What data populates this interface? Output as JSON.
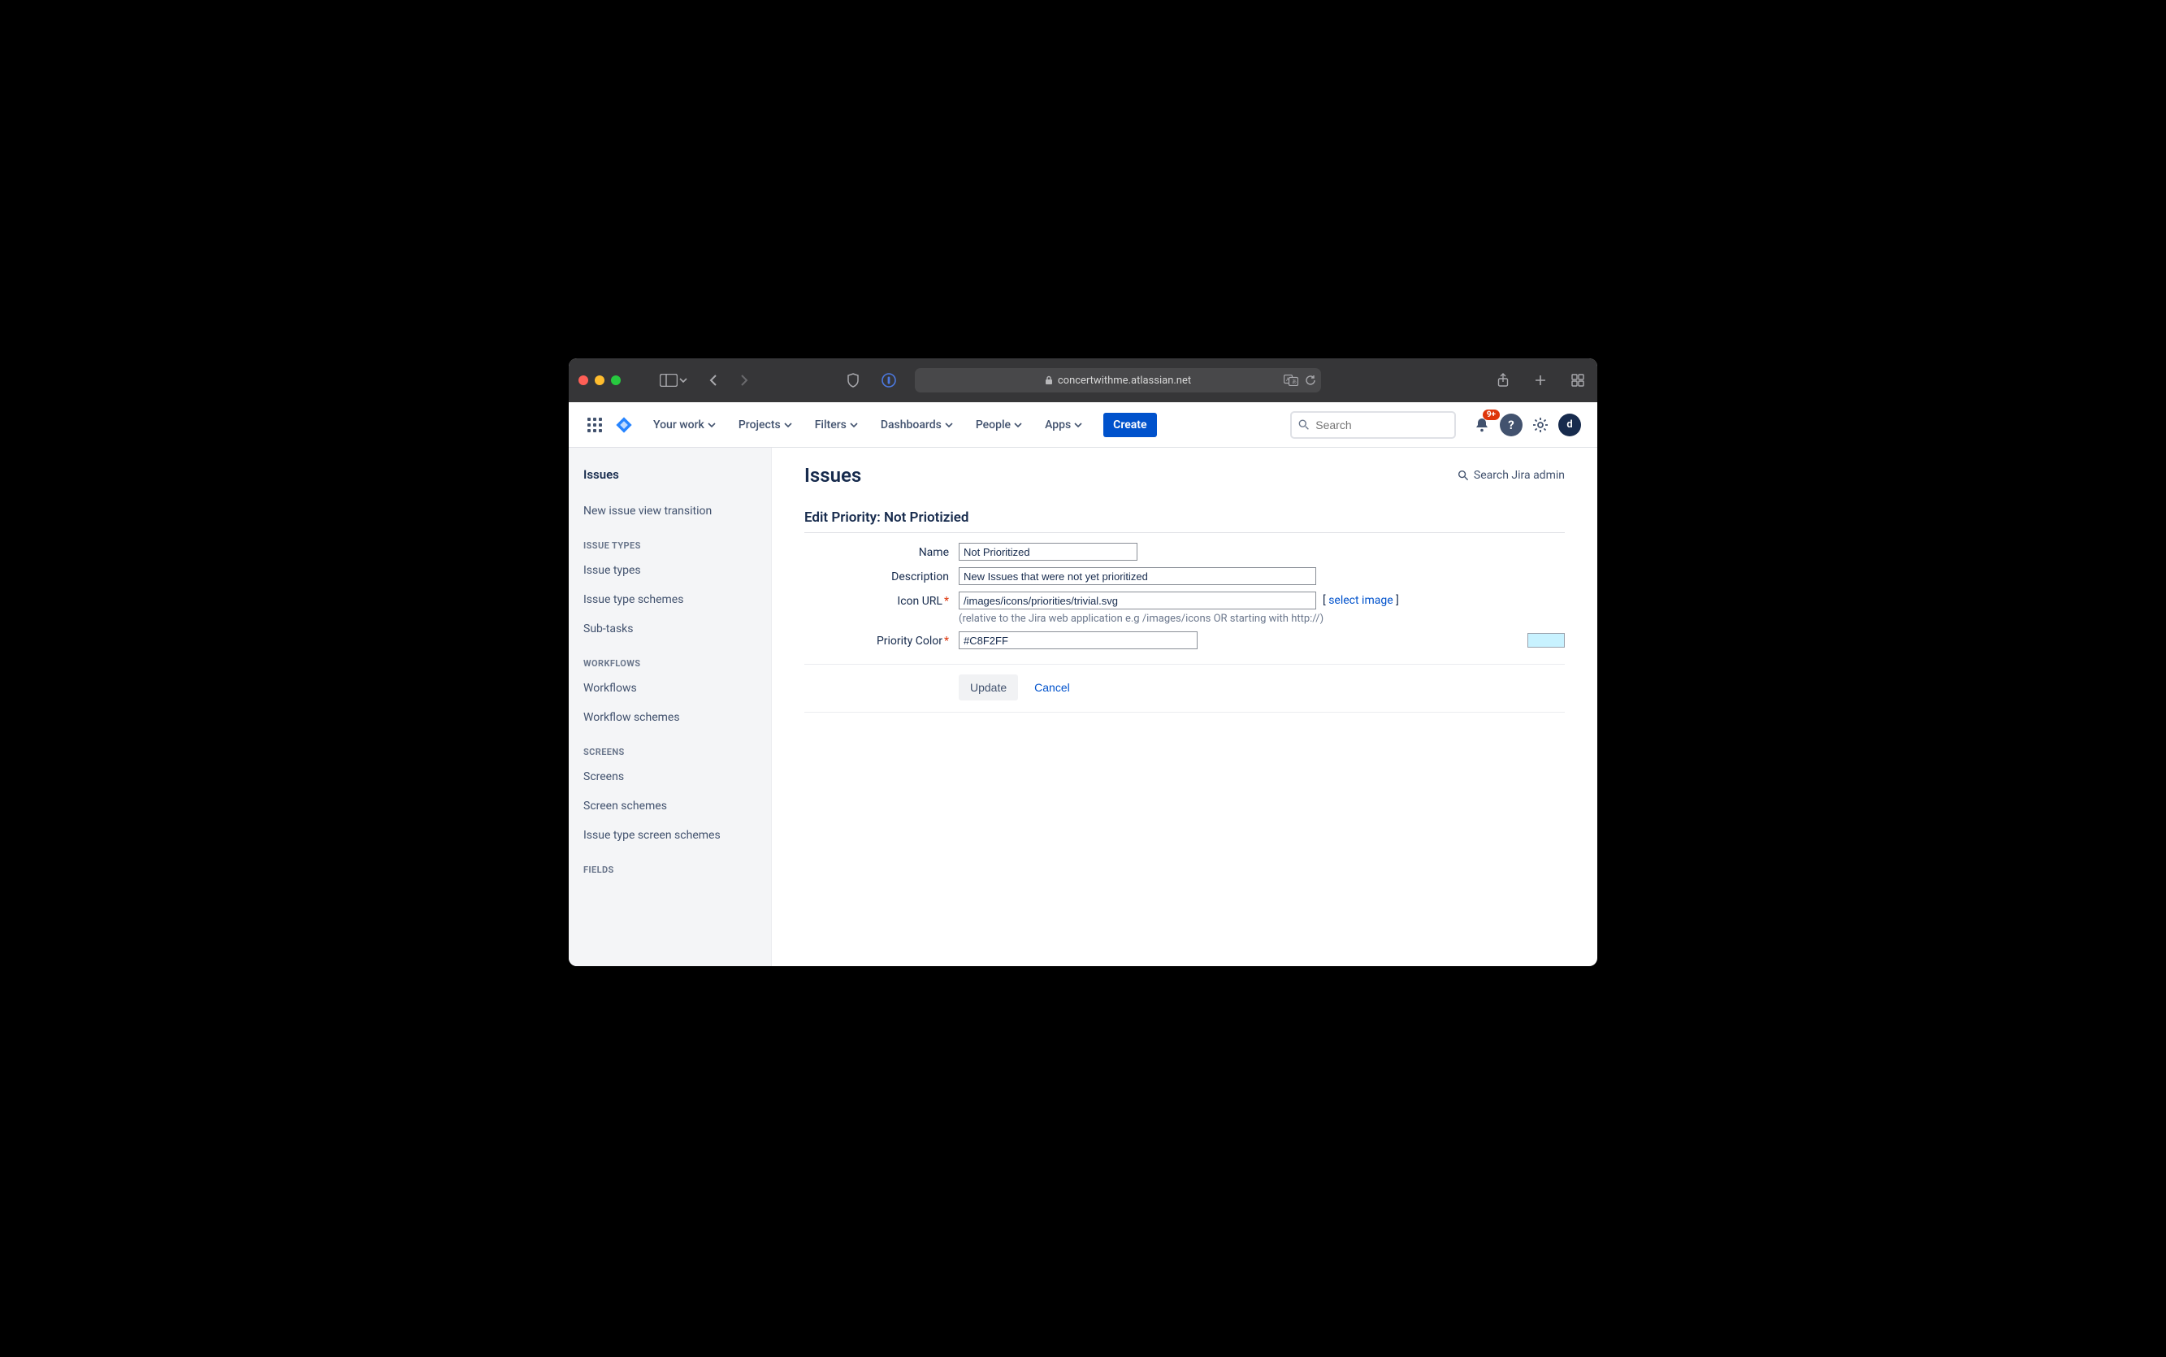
{
  "browser": {
    "url": "concertwithme.atlassian.net"
  },
  "nav": {
    "items": [
      "Your work",
      "Projects",
      "Filters",
      "Dashboards",
      "People",
      "Apps"
    ],
    "create": "Create",
    "search_placeholder": "Search",
    "notif_badge": "9+",
    "avatar_initial": "d"
  },
  "sidebar": {
    "title": "Issues",
    "top_link": "New issue view transition",
    "sections": [
      {
        "label": "ISSUE TYPES",
        "items": [
          "Issue types",
          "Issue type schemes",
          "Sub-tasks"
        ]
      },
      {
        "label": "WORKFLOWS",
        "items": [
          "Workflows",
          "Workflow schemes"
        ]
      },
      {
        "label": "SCREENS",
        "items": [
          "Screens",
          "Screen schemes",
          "Issue type screen schemes"
        ]
      },
      {
        "label": "FIELDS",
        "items": []
      }
    ]
  },
  "main": {
    "page_title": "Issues",
    "search_admin": "Search Jira admin",
    "form_title": "Edit Priority: Not Priotizied",
    "labels": {
      "name": "Name",
      "description": "Description",
      "icon_url": "Icon URL",
      "priority_color": "Priority Color"
    },
    "values": {
      "name": "Not Prioritized",
      "description": "New Issues that were not yet prioritized",
      "icon_url": "/images/icons/priorities/trivial.svg",
      "priority_color": "#C8F2FF"
    },
    "select_image": "select image",
    "icon_url_hint": "(relative to the Jira web application e.g /images/icons OR starting with http://)",
    "update": "Update",
    "cancel": "Cancel"
  }
}
